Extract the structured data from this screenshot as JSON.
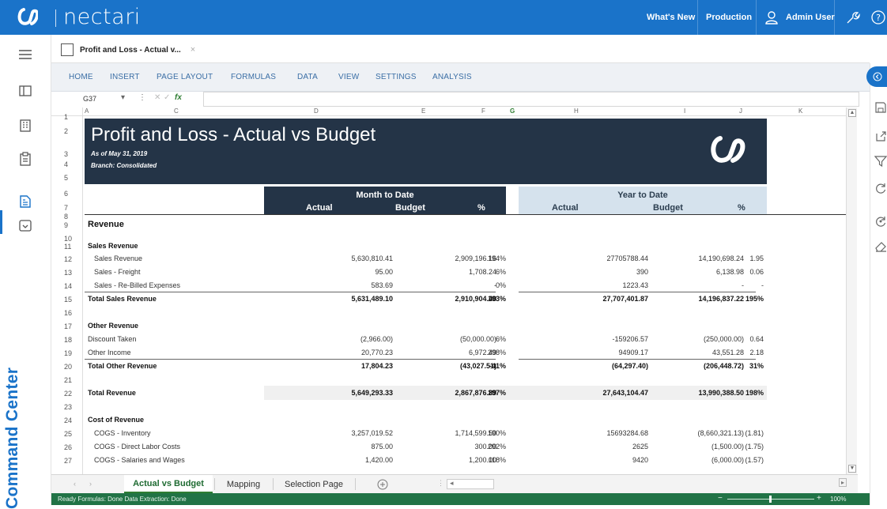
{
  "app": {
    "brand": "nectari",
    "nav": [
      "What's New",
      "Production",
      "Admin User"
    ],
    "side_label": "Command Center",
    "accent": "#1a73c9"
  },
  "doc_tab": {
    "title": "Profit and Loss - Actual v...",
    "close": "×"
  },
  "ribbon": {
    "tabs": [
      "HOME",
      "INSERT",
      "PAGE LAYOUT",
      "FORMULAS",
      "DATA",
      "VIEW",
      "SETTINGS",
      "ANALYSIS"
    ]
  },
  "formula_bar": {
    "cell_ref": "G37",
    "fx": "fx",
    "value": ""
  },
  "columns": [
    "A",
    "C",
    "D",
    "E",
    "F",
    "G",
    "H",
    "I",
    "J",
    "K"
  ],
  "report": {
    "title": "Profit and Loss - Actual vs Budget",
    "as_of": "As of May 31, 2019",
    "branch": "Branch: Consolidated",
    "mtd_label": "Month to Date",
    "ytd_label": "Year to Date",
    "col_actual": "Actual",
    "col_budget": "Budget",
    "col_pct": "%"
  },
  "row_numbers": [
    "1",
    "2",
    "3",
    "4",
    "5",
    "6",
    "7",
    "8",
    "9",
    "10",
    "11",
    "12",
    "13",
    "14",
    "15",
    "16",
    "17",
    "18",
    "19",
    "20",
    "21",
    "22",
    "23",
    "24",
    "25",
    "26",
    "27"
  ],
  "rows": [
    {
      "n": "9",
      "label": "Revenue",
      "kind": "section",
      "v": [
        "",
        "",
        "",
        "",
        "",
        ""
      ]
    },
    {
      "n": "11",
      "label": "Sales Revenue",
      "kind": "group",
      "v": [
        "",
        "",
        "",
        "",
        "",
        ""
      ]
    },
    {
      "n": "12",
      "label": "Sales Revenue",
      "kind": "item",
      "v": [
        "5,630,810.41",
        "2,909,196.16",
        "194%",
        "27705788.44",
        "14,190,698.24",
        "1.95"
      ]
    },
    {
      "n": "13",
      "label": "Sales - Freight",
      "kind": "item",
      "v": [
        "95.00",
        "1,708.24",
        "6%",
        "390",
        "6,138.98",
        "0.06"
      ]
    },
    {
      "n": "14",
      "label": "Sales - Re-Billed Expenses",
      "kind": "item",
      "v": [
        "583.69",
        "-",
        "0%",
        "1223.43",
        "-",
        "-"
      ]
    },
    {
      "n": "15",
      "label": "Total Sales Revenue",
      "kind": "total",
      "v": [
        "5,631,489.10",
        "2,910,904.40",
        "193%",
        "27,707,401.87",
        "14,196,837.22",
        "195%"
      ]
    },
    {
      "n": "17",
      "label": "Other Revenue",
      "kind": "group",
      "v": [
        "",
        "",
        "",
        "",
        "",
        ""
      ]
    },
    {
      "n": "18",
      "label": "Discount Taken",
      "kind": "plain",
      "v": [
        "(2,966.00)",
        "(50,000.00)",
        "6%",
        "-159206.57",
        "(250,000.00)",
        "0.64"
      ]
    },
    {
      "n": "19",
      "label": "Other Income",
      "kind": "plain",
      "v": [
        "20,770.23",
        "6,972.49",
        "298%",
        "94909.17",
        "43,551.28",
        "2.18"
      ]
    },
    {
      "n": "20",
      "label": "Total Other Revenue",
      "kind": "total",
      "v": [
        "17,804.23",
        "(43,027.51)",
        "-41%",
        "(64,297.40)",
        "(206,448.72)",
        "31%"
      ]
    },
    {
      "n": "22",
      "label": "Total Revenue",
      "kind": "grand",
      "v": [
        "5,649,293.33",
        "2,867,876.89",
        "197%",
        "27,643,104.47",
        "13,990,388.50",
        "198%"
      ]
    },
    {
      "n": "24",
      "label": "Cost of Revenue",
      "kind": "group",
      "v": [
        "",
        "",
        "",
        "",
        "",
        ""
      ]
    },
    {
      "n": "25",
      "label": "COGS - Inventory",
      "kind": "item",
      "v": [
        "3,257,019.52",
        "1,714,599.50",
        "190%",
        "15693284.68",
        "(8,660,321.13)",
        "(1.81)"
      ]
    },
    {
      "n": "26",
      "label": "COGS - Direct Labor Costs",
      "kind": "item",
      "v": [
        "875.00",
        "300.00",
        "292%",
        "2625",
        "(1,500.00)",
        "(1.75)"
      ]
    },
    {
      "n": "27",
      "label": "COGS - Salaries and Wages",
      "kind": "item",
      "v": [
        "1,420.00",
        "1,200.00",
        "118%",
        "9420",
        "(6,000.00)",
        "(1.57)"
      ]
    }
  ],
  "sheet_tabs": [
    "Actual vs Budget",
    "Mapping",
    "Selection Page"
  ],
  "status": {
    "text": "Ready   Formulas: Done   Data Extraction: Done",
    "zoom": "100%"
  }
}
